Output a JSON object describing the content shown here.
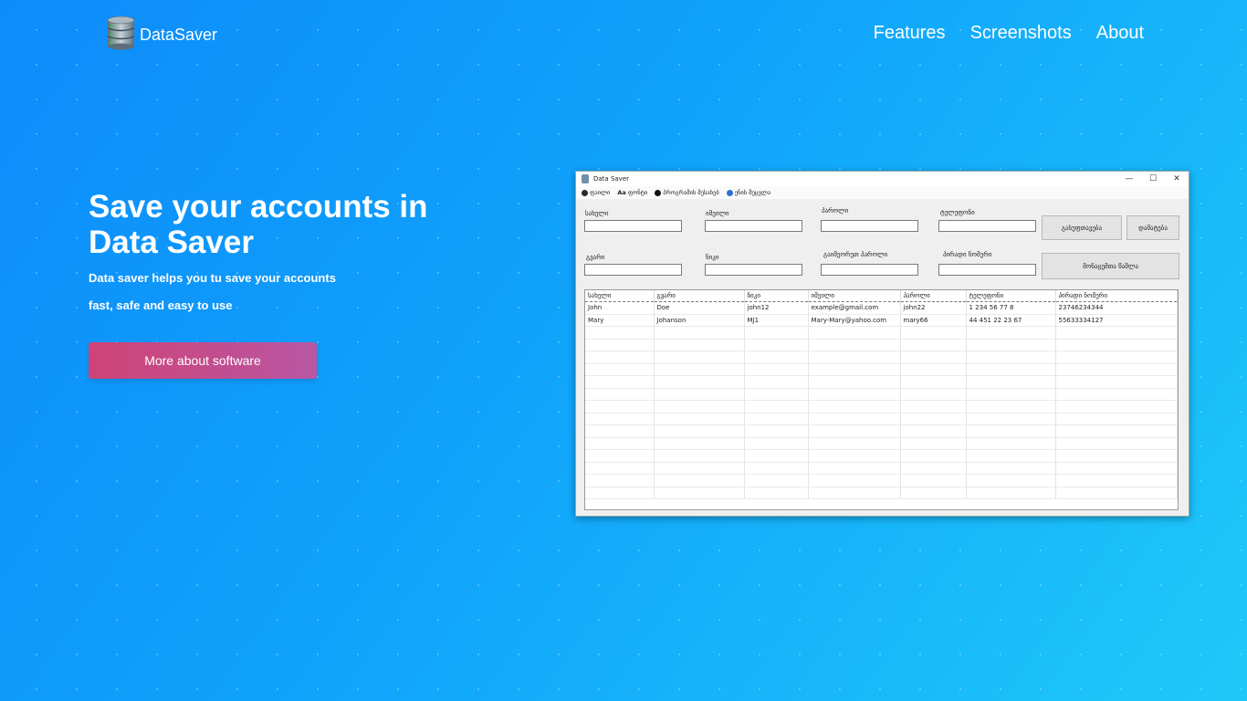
{
  "header": {
    "brand": "DataSaver",
    "nav": [
      "Features",
      "Screenshots",
      "About"
    ]
  },
  "hero": {
    "title": "Save your accounts in Data Saver",
    "subtitle_line1": "Data saver helps you tu save your accounts",
    "subtitle_line2": "fast, safe and easy to use",
    "cta": "More about software"
  },
  "app": {
    "window_title": "Data Saver",
    "controls": {
      "minimize": "—",
      "maximize": "☐",
      "close": "✕"
    },
    "menu": [
      {
        "label": "ფაილი",
        "icon": "user-gear-icon",
        "color": "#2a2a2a"
      },
      {
        "label": "ფონტი",
        "icon": "font-icon",
        "color": "#2a2a2a"
      },
      {
        "label": "პროგრამის შესახებ",
        "icon": "info-icon",
        "color": "#111"
      },
      {
        "label": "ენის შეცვლა",
        "icon": "language-icon",
        "color": "#2d6fd0"
      }
    ],
    "font_icon_text": "Aa",
    "form": {
      "first_name_label": "სახელი",
      "email_label": "იმეილი",
      "password_label": "პაროლი",
      "phone_label": "ტელეფონი",
      "last_name_label": "გვარი",
      "nickname_label": "ნიკი",
      "repeat_password_label": "გაიმეორეთ პაროლი",
      "personal_number_label": "პირადი ნომერი",
      "clear_button": "გასუფთავება",
      "add_button": "დამატება",
      "delete_button": "მონაცემთა წაშლა"
    },
    "table": {
      "columns": [
        "სახელი",
        "გვარი",
        "ნიკი",
        "იმეილი",
        "პაროლი",
        "ტელეფონი",
        "პირადი ნომერი"
      ],
      "rows": [
        [
          "John",
          "Doe",
          "john12",
          "example@gmail.com",
          "john22",
          "1 234 56 77 8",
          "23746234344"
        ],
        [
          "Mary",
          "Johanson",
          "MJ1",
          "Mary-Mary@yahoo.com",
          "mary66",
          "44 451 22 23 67",
          "55633334127"
        ]
      ],
      "empty_rows": 14
    }
  }
}
